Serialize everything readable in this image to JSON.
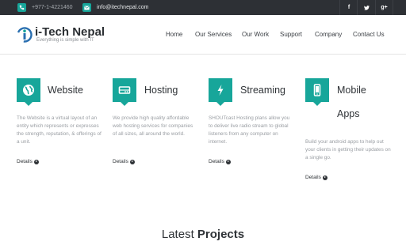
{
  "topbar": {
    "phone": "+977-1-4221460",
    "email": "info@itechnepal.com",
    "social": [
      "f",
      "t",
      "g+"
    ]
  },
  "header": {
    "brand": "i-Tech Nepal",
    "tagline": "Everything is simple with IT",
    "nav": [
      "Home",
      "Our Services",
      "Our Work",
      "Support",
      "Company",
      "Contact Us"
    ]
  },
  "services": [
    {
      "icon": "globe-icon",
      "title": "Website",
      "desc": "The Website is a virtual layout of an entity which represents or expresses the strength, reputation, & offerings of a unit.",
      "link": "Details"
    },
    {
      "icon": "server-icon",
      "title": "Hosting",
      "desc": "We provide high quality affordable web hosting services for companies of all sizes, all around the world.",
      "link": "Details"
    },
    {
      "icon": "lightning-icon",
      "title": "Streaming",
      "desc": "SHOUTcast Hosting plans allow you to deliver live radio stream to global listeners from any computer on internet.",
      "link": "Details"
    },
    {
      "icon": "mobile-icon",
      "title_line1": "Mobile",
      "title_line2": "Apps",
      "desc": "Build your android apps to help out your clients in getting their updates on a single go.",
      "link": "Details"
    }
  ],
  "projects_heading": {
    "light": "Latest ",
    "bold": "Projects"
  },
  "colors": {
    "accent": "#17a69a",
    "topbar": "#2d3035"
  }
}
